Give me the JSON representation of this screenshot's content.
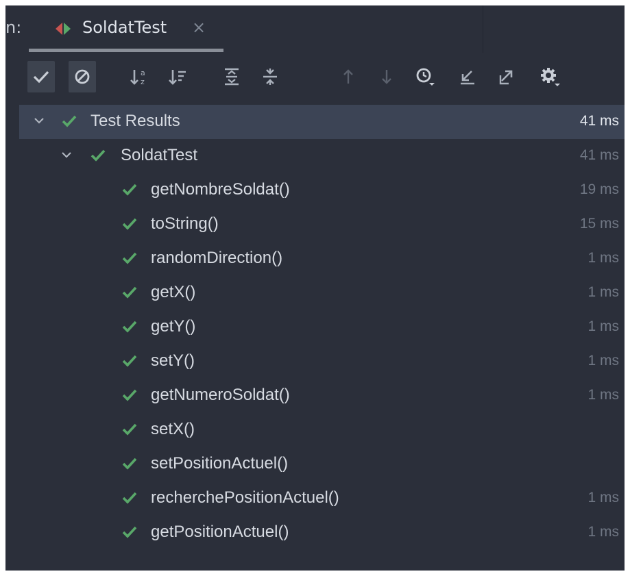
{
  "header": {
    "run_prefix": "n:",
    "tab_title": "SoldatTest",
    "tab_close": "×"
  },
  "toolbar": {
    "icons": [
      "check-icon",
      "ignored-icon",
      "sort-alphabetical-icon",
      "sort-by-duration-icon",
      "expand-all-icon",
      "collapse-all-icon",
      "arrow-up-icon",
      "arrow-down-icon",
      "history-icon",
      "import-icon",
      "export-icon",
      "settings-icon"
    ]
  },
  "tree": {
    "root": {
      "label": "Test Results",
      "time": "41 ms",
      "status": "passed"
    },
    "suite": {
      "label": "SoldatTest",
      "time": "41 ms",
      "status": "passed"
    },
    "tests": [
      {
        "label": "getNombreSoldat()",
        "time": "19 ms"
      },
      {
        "label": "toString()",
        "time": "15 ms"
      },
      {
        "label": "randomDirection()",
        "time": "1 ms"
      },
      {
        "label": "getX()",
        "time": "1 ms"
      },
      {
        "label": "getY()",
        "time": "1 ms"
      },
      {
        "label": "setY()",
        "time": "1 ms"
      },
      {
        "label": "getNumeroSoldat()",
        "time": "1 ms"
      },
      {
        "label": "setX()",
        "time": ""
      },
      {
        "label": "setPositionActuel()",
        "time": ""
      },
      {
        "label": "recherchePositionActuel()",
        "time": "1 ms"
      },
      {
        "label": "getPositionActuel()",
        "time": "1 ms"
      }
    ]
  },
  "colors": {
    "background": "#2b2f3a",
    "selection": "#3c4455",
    "pass_green": "#59a869",
    "run_red": "#c75450"
  }
}
